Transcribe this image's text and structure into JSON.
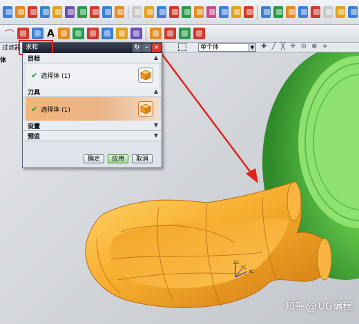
{
  "toolbar_row1_colors": [
    "#3d7fd6",
    "#e38b1f",
    "#d0392b",
    "#3b83c8",
    "#e2a21a",
    "#6d4fb3",
    "#2b9a48",
    "#d0392b",
    "#3d7fd6",
    "#e38b1f",
    "#c9c9c9",
    "#e2a21a",
    "#3d7fd6",
    "#d0392b",
    "#2b9a48",
    "#e38b1f",
    "#c94c8e",
    "#3d7fd6",
    "#e2a21a",
    "#d0392b",
    "#3b83c8",
    "#2b9a48",
    "#e38b1f",
    "#3d7fd6",
    "#d0392b",
    "#c9c9c9",
    "#e2a21a",
    "#3d7fd6"
  ],
  "toolbar_row2": {
    "letter_a": "A",
    "colors": [
      "#d0392b",
      "#3d7fd6",
      "#e38b1f",
      "#2b9a48",
      "#d0392b",
      "#3d7fd6",
      "#e2a21a",
      "#6d4fb3",
      "#d0392b",
      "#3d7fd6",
      "#e38b1f",
      "#2b9a48"
    ]
  },
  "filter_bar": {
    "filter_label": "过滤器",
    "selection_type": "单个体"
  },
  "side_label": "体",
  "dialog": {
    "title": "求和",
    "reset_glyph": "↻",
    "minimize_glyph": "–",
    "close_glyph": "×",
    "sections": {
      "target": {
        "header": "目标",
        "check": "✔",
        "label": "选择体 (1)"
      },
      "tool": {
        "header": "刀具",
        "check": "✔",
        "label": "选择体 (1)"
      },
      "settings": {
        "header": "设置"
      },
      "preview": {
        "header": "预览"
      }
    },
    "buttons": {
      "ok": "确定",
      "apply": "应用",
      "cancel": "取消"
    }
  },
  "axis_labels": {
    "zc": "ZC",
    "yc": "YC",
    "xc": "XC"
  },
  "watermark": {
    "brand": "知乎",
    "separator": "@",
    "author": "UG编程"
  },
  "colors": {
    "highlight": "#e0241b",
    "model_orange": "#f4a52b",
    "model_green": "#5ac04a",
    "dialog_titlebar": "#1c2230"
  }
}
